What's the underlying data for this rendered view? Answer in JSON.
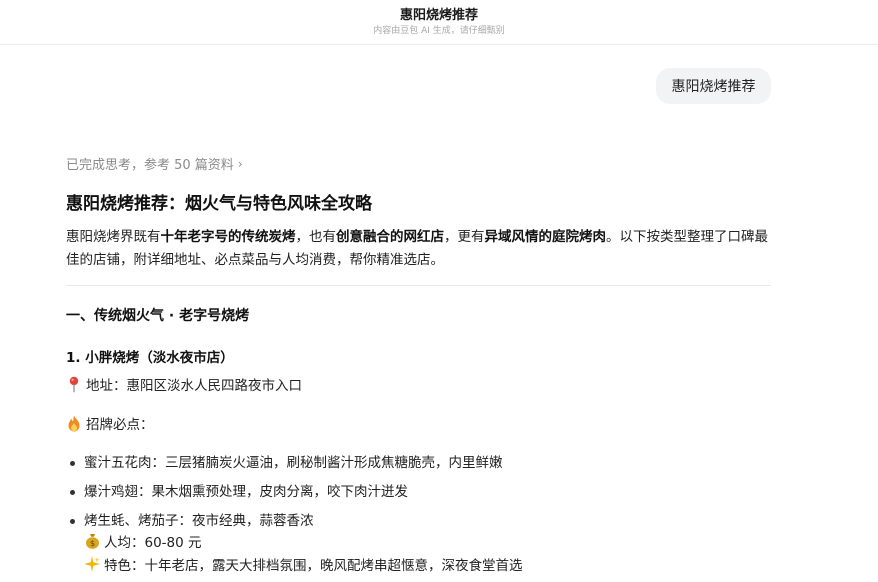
{
  "header": {
    "title": "惠阳烧烤推荐",
    "subtitle": "内容由豆包 AI 生成，请仔细甄别"
  },
  "user_message": "惠阳烧烤推荐",
  "thinking": {
    "label": "已完成思考，参考 50 篇资料",
    "chevron": "›"
  },
  "answer": {
    "title": "惠阳烧烤推荐：烟火气与特色风味全攻略",
    "intro": {
      "p1": "惠阳烧烤界既有",
      "b1": "十年老字号的传统炭烤",
      "p2": "，也有",
      "b2": "创意融合的网红店",
      "p3": "，更有",
      "b3": "异域风情的庭院烤肉",
      "p4": "。以下按类型整理了口碑最佳的店铺，附详细地址、必点菜品与人均消费，帮你精准选店。"
    },
    "section1": {
      "heading": "一、传统烟火气 · 老字号烧烤",
      "shop1": {
        "name": "1. 小胖烧烤（淡水夜市店）",
        "address": "地址：惠阳区淡水人民四路夜市入口",
        "signature_label": "招牌必点：",
        "dishes": [
          "蜜汁五花肉：三层猪腩炭火逼油，刷秘制酱汁形成焦糖脆壳，内里鲜嫩",
          "爆汁鸡翅：果木烟熏预处理，皮肉分离，咬下肉汁迸发",
          "烤生蚝、烤茄子：夜市经典，蒜蓉香浓"
        ],
        "price": "人均：60-80 元",
        "feature": "特色：十年老店，露天大排档氛围，晚风配烤串超惬意，深夜食堂首选"
      }
    }
  },
  "icons": {
    "address": "pin-icon",
    "signature": "fire-icon",
    "price": "money-bag-icon",
    "feature": "sparkle-icon"
  },
  "colors": {
    "bubble_bg": "#f2f3f5",
    "muted_text": "#8a8a8a",
    "pin_red": "#e0443a",
    "fire_orange": "#f08a24",
    "money_gold": "#d9a520"
  }
}
